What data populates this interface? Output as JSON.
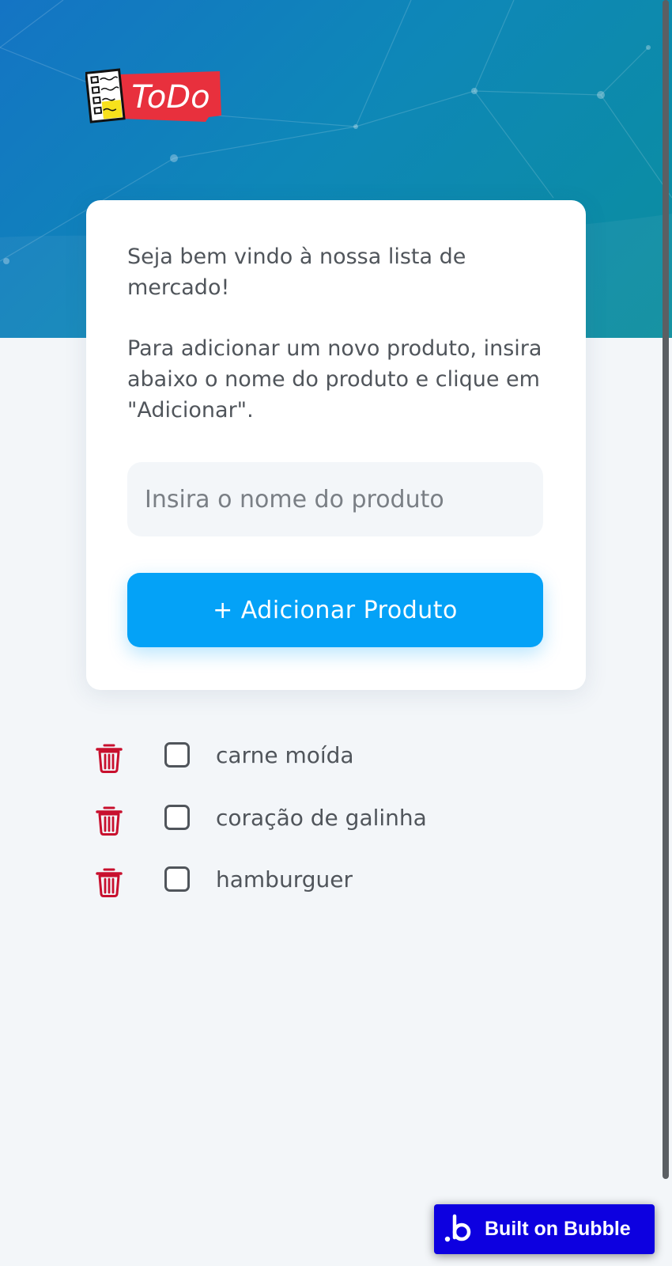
{
  "header": {
    "logo_text": "ToDo",
    "colors": {
      "gradient_start": "#1474c4",
      "gradient_end": "#0b8e9e",
      "logo_red": "#e8303d"
    }
  },
  "card": {
    "welcome": "Seja bem vindo à nossa lista de mercado!",
    "instructions": "Para adicionar um novo produto, insira abaixo o nome do produto e clique em \"Adicionar\".",
    "input_value": "",
    "input_placeholder": "Insira o nome do produto",
    "add_button_label": "+ Adicionar Produto",
    "accent_color": "#04a2f7"
  },
  "list": {
    "items": [
      {
        "label": "carne moída",
        "checked": false,
        "delete_icon": "trash-icon"
      },
      {
        "label": "coração de galinha",
        "checked": false,
        "delete_icon": "trash-icon"
      },
      {
        "label": "hamburguer",
        "checked": false,
        "delete_icon": "trash-icon"
      }
    ],
    "delete_color": "#c8102e"
  },
  "footer": {
    "badge_label": "Built on Bubble",
    "badge_icon": "bubble-logo-icon",
    "badge_color": "#0d00e0"
  }
}
